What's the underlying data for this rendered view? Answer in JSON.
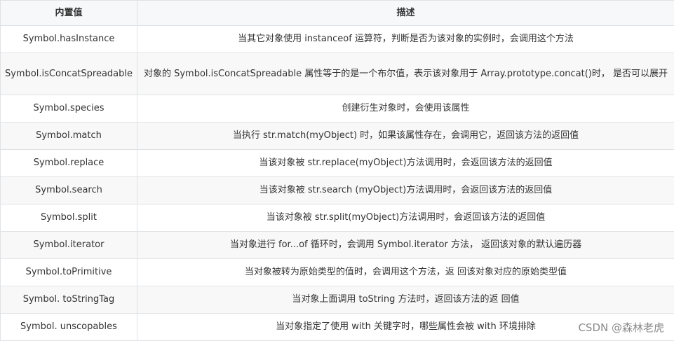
{
  "table": {
    "headers": [
      "内置值",
      "描述"
    ],
    "rows": [
      {
        "name": "Symbol.hasInstance",
        "desc": "当其它对象使用 instanceof 运算符，判断是否为该对象的实例时，会调用这个方法"
      },
      {
        "name": "Symbol.isConcatSpreadable",
        "desc": "对象的 Symbol.isConcatSpreadable 属性等于的是一个布尔值，表示该对象用于 Array.prototype.concat()时， 是否可以展开"
      },
      {
        "name": "Symbol.species",
        "desc": "创建衍生对象时，会使用该属性"
      },
      {
        "name": "Symbol.match",
        "desc": "当执行 str.match(myObject) 时，如果该属性存在，会调用它，返回该方法的返回值"
      },
      {
        "name": "Symbol.replace",
        "desc": "当该对象被 str.replace(myObject)方法调用时，会返回该方法的返回值"
      },
      {
        "name": "Symbol.search",
        "desc": "当该对象被 str.search (myObject)方法调用时，会返回该方法的返回值"
      },
      {
        "name": "Symbol.split",
        "desc": "当该对象被 str.split(myObject)方法调用时，会返回该方法的返回值"
      },
      {
        "name": "Symbol.iterator",
        "desc": "当对象进行 for...of 循环时，会调用 Symbol.iterator 方法， 返回该对象的默认遍历器"
      },
      {
        "name": "Symbol.toPrimitive",
        "desc": "当对象被转为原始类型的值时，会调用这个方法，返 回该对象对应的原始类型值"
      },
      {
        "name": "Symbol. toStringTag",
        "desc": "当对象上面调用 toString 方法时，返回该方法的返 回值"
      },
      {
        "name": "Symbol. unscopables",
        "desc": "当对象指定了使用 with 关键字时，哪些属性会被 with 环境排除"
      }
    ]
  },
  "watermark": "CSDN @森林老虎"
}
